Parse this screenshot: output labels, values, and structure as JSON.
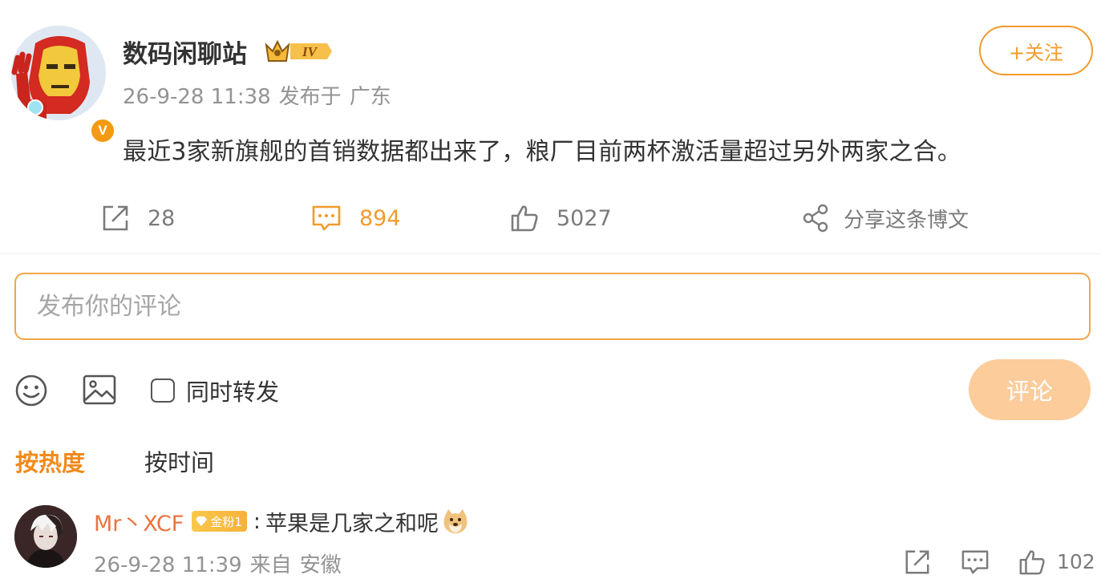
{
  "post": {
    "author": "数码闲聊站",
    "level_badge": "IV",
    "verified_badge": "V",
    "time": "26-9-28 11:38",
    "published_label": "发布于",
    "location": "广东",
    "follow_label": "+关注",
    "text": "最近3家新旗舰的首销数据都出来了，粮厂目前两杯激活量超过另外两家之合。",
    "actions": {
      "repost_count": "28",
      "comment_count": "894",
      "like_count": "5027",
      "share_label": "分享这条博文"
    }
  },
  "composer": {
    "placeholder": "发布你的评论",
    "repost_label": "同时转发",
    "submit_label": "评论"
  },
  "sort": {
    "hot": "按热度",
    "time": "按时间"
  },
  "comments": [
    {
      "user": "Mr丶XCF",
      "fan_badge": "金粉1",
      "separator": ":",
      "text": "苹果是几家之和呢",
      "time": "26-9-28 11:39",
      "from_label": "来自",
      "location": "安徽",
      "like_count": "102"
    }
  ],
  "colors": {
    "accent": "#f29b2b",
    "submit_disabled": "#fccc9b",
    "username": "#eb7340",
    "muted": "#939393"
  },
  "icons": [
    "verified-icon",
    "level-crown-icon",
    "repost-icon",
    "comment-icon",
    "like-icon",
    "share-icon",
    "emoji-icon",
    "image-icon",
    "checkbox-icon",
    "fan-badge-icon",
    "doge-emoji"
  ]
}
